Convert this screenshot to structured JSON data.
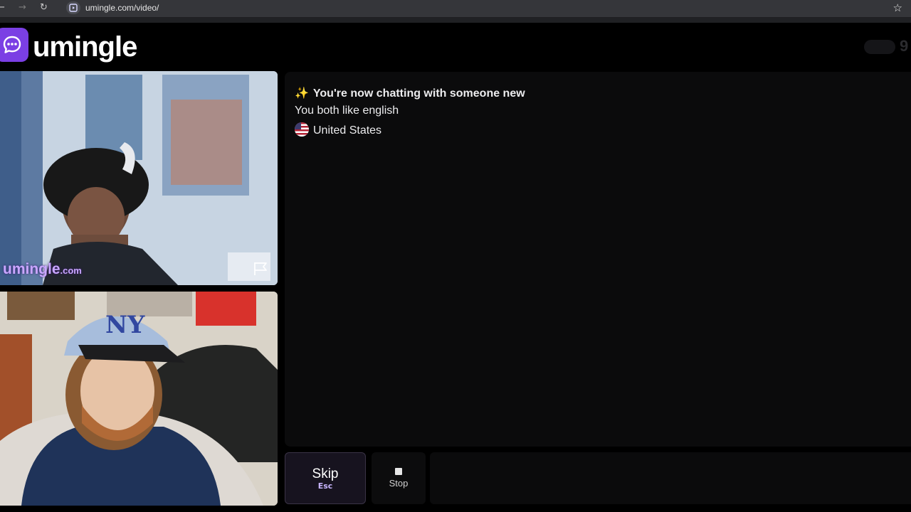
{
  "browser": {
    "url": "umingle.com/video/"
  },
  "header": {
    "logo_text": "umingle",
    "online_count": "9"
  },
  "video": {
    "watermark_main": "umingle",
    "watermark_domain": ".com"
  },
  "chat": {
    "messages": [
      {
        "icon": "sparkles-icon",
        "text": "You're now chatting with someone new"
      },
      {
        "text": "You both like english"
      },
      {
        "icon": "us-flag-icon",
        "text": "United States"
      }
    ]
  },
  "controls": {
    "skip_label": "Skip",
    "skip_key": "Esc",
    "stop_label": "Stop",
    "message_placeholder": ""
  },
  "colors": {
    "brand": "#7b3fe4",
    "watermark": "#c9a6ff",
    "background": "#000000",
    "panel": "#0b0b0c"
  }
}
